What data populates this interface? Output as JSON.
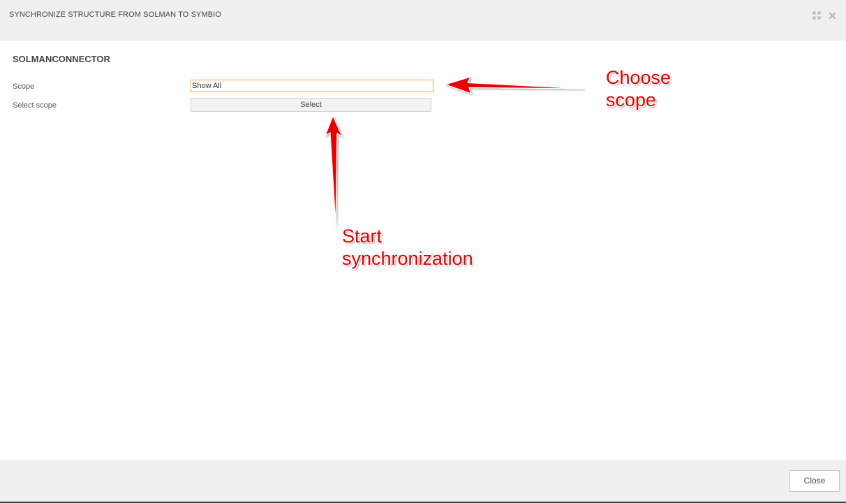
{
  "dialog": {
    "title": "SYNCHRONIZE STRUCTURE FROM SOLMAN TO SYMBIO",
    "header_buttons": [
      {
        "icon": "maximize-icon"
      },
      {
        "icon": "close-icon"
      }
    ]
  },
  "section": {
    "title": "SOLMANCONNECTOR"
  },
  "form": {
    "scope_label": "Scope",
    "scope_value": "Show All",
    "select_scope_label": "Select scope",
    "select_button_label": "Select"
  },
  "footer": {
    "close_button_label": "Close"
  },
  "annotations": {
    "choose_scope": "Choose\nscope",
    "start_sync": "Start\nsynchronization",
    "color": "#e00000"
  }
}
